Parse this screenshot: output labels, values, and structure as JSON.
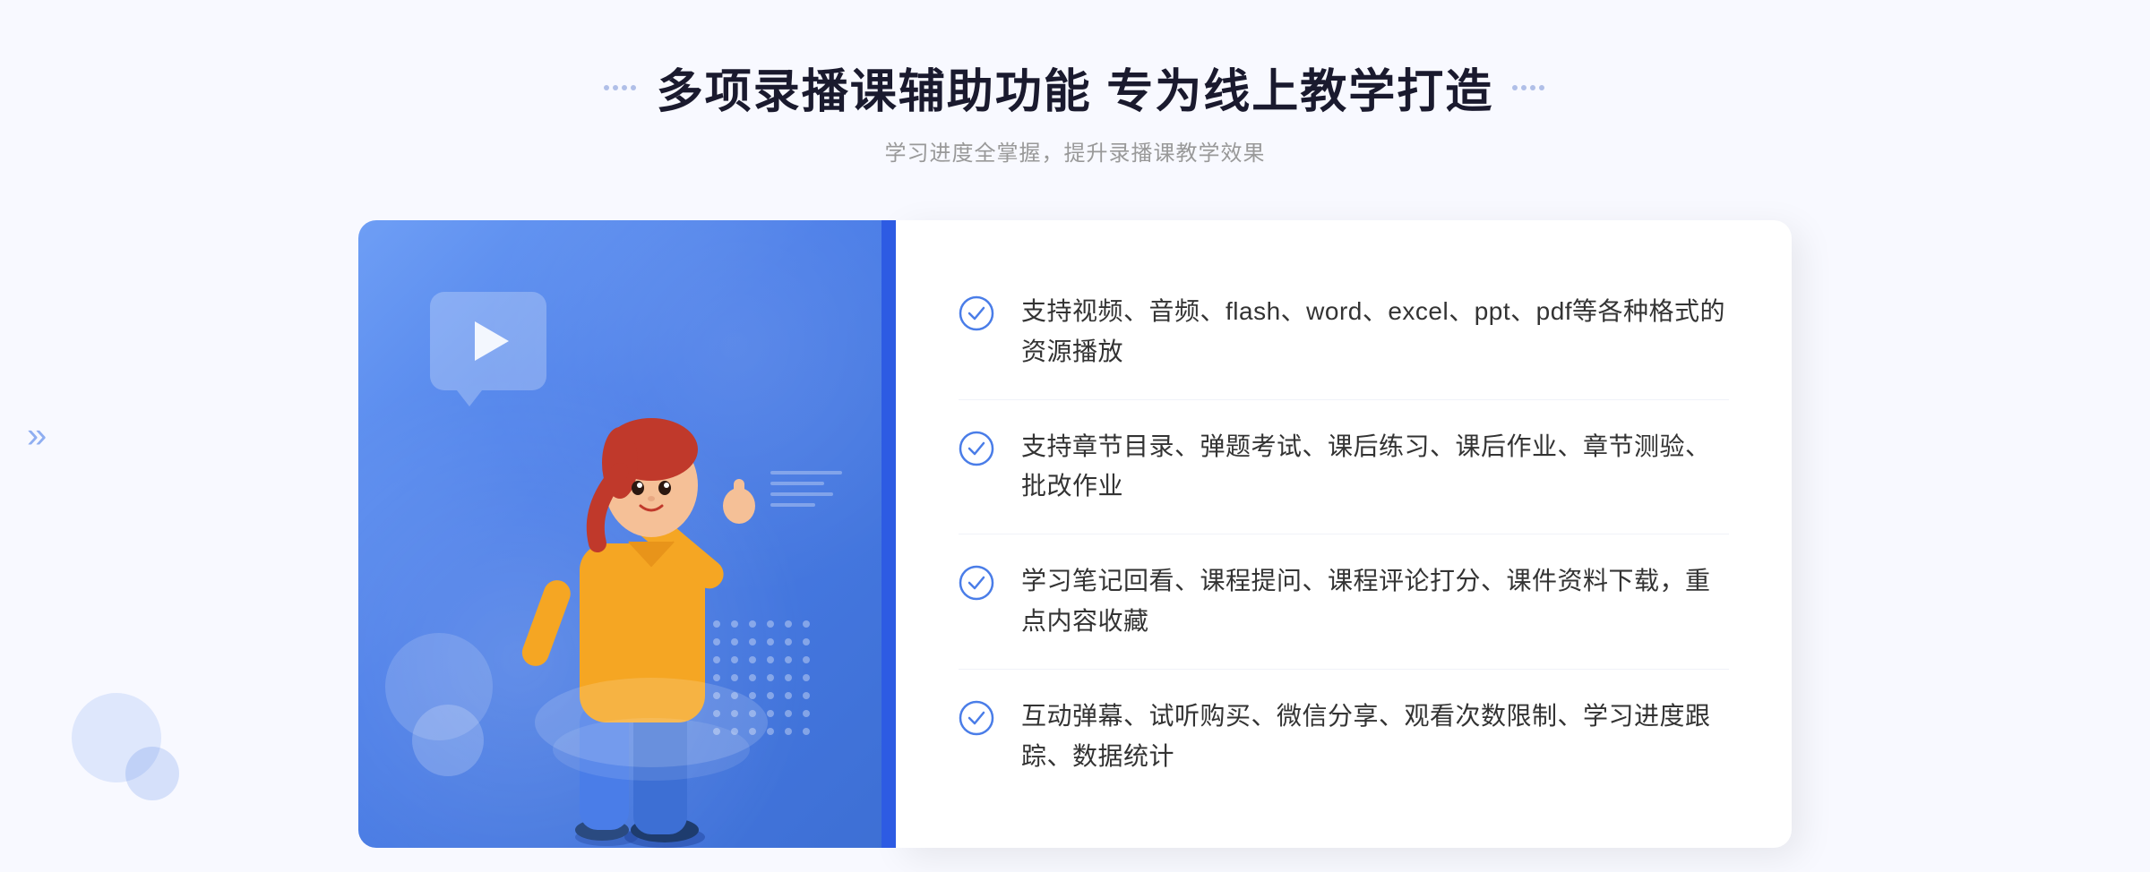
{
  "header": {
    "title": "多项录播课辅助功能 专为线上教学打造",
    "subtitle": "学习进度全掌握，提升录播课教学效果",
    "decoration_dots": [
      "●",
      "●",
      "●",
      "●"
    ]
  },
  "features": [
    {
      "id": 1,
      "text": "支持视频、音频、flash、word、excel、ppt、pdf等各种格式的资源播放"
    },
    {
      "id": 2,
      "text": "支持章节目录、弹题考试、课后练习、课后作业、章节测验、批改作业"
    },
    {
      "id": 3,
      "text": "学习笔记回看、课程提问、课程评论打分、课件资料下载，重点内容收藏"
    },
    {
      "id": 4,
      "text": "互动弹幕、试听购买、微信分享、观看次数限制、学习进度跟踪、数据统计"
    }
  ],
  "illustration": {
    "play_icon": "▶",
    "arrow_left": "»"
  }
}
